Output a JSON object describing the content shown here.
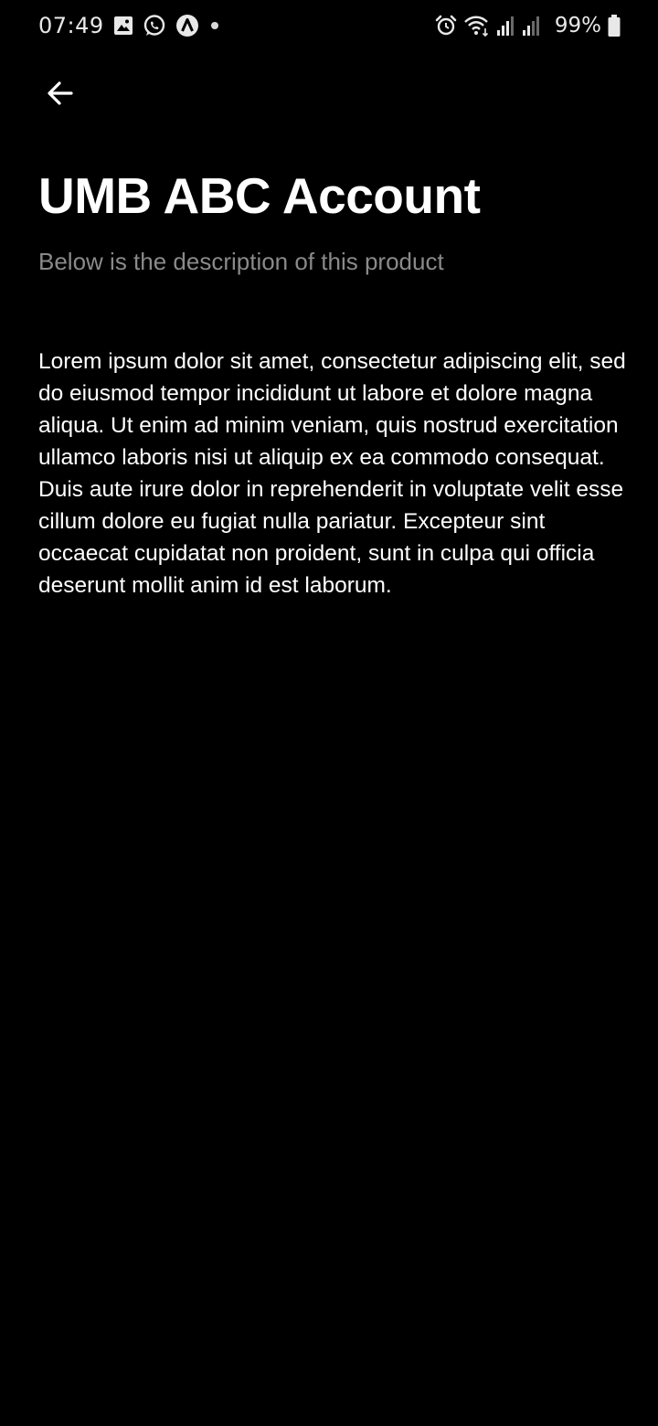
{
  "status_bar": {
    "time": "07:49",
    "battery_percent": "99%",
    "left_icons": [
      "gallery-icon",
      "whatsapp-icon",
      "app-a-icon",
      "dot-icon"
    ],
    "right_icons": [
      "alarm-icon",
      "wifi-icon",
      "signal-icon",
      "signal-icon",
      "battery-icon"
    ]
  },
  "header": {
    "back_icon": "arrow-left-icon"
  },
  "main": {
    "title": "UMB ABC Account",
    "subtitle": "Below is the description of this product",
    "description": "Lorem ipsum dolor sit amet, consectetur adipiscing elit, sed do eiusmod tempor incididunt ut labore et dolore magna aliqua. Ut enim ad minim veniam, quis nostrud exercitation ullamco laboris nisi ut aliquip ex ea commodo consequat. Duis aute irure dolor in reprehenderit in voluptate velit esse cillum dolore eu fugiat nulla pariatur. Excepteur sint occaecat cupidatat non proident, sunt in culpa qui officia deserunt mollit anim id est laborum."
  },
  "colors": {
    "background": "#000000",
    "title": "#ffffff",
    "subtitle": "#8a8a8a",
    "body_text": "#ffffff"
  }
}
